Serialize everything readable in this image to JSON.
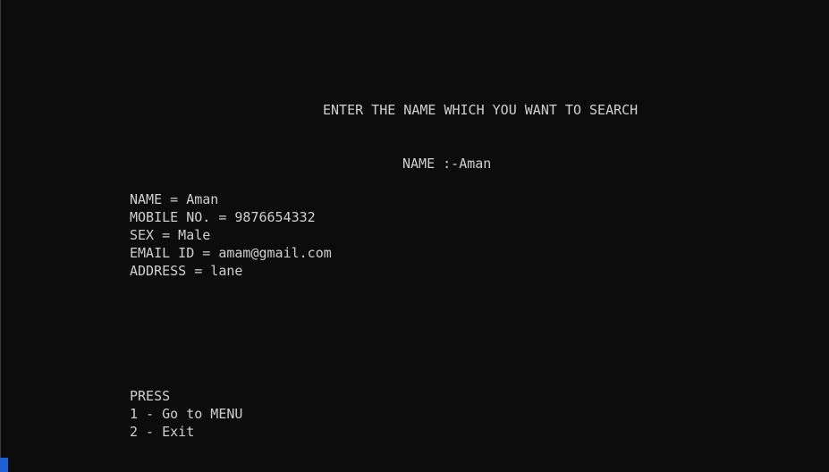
{
  "console": {
    "prompt": "ENTER THE NAME WHICH YOU WANT TO SEARCH",
    "name_input": "NAME :-Aman",
    "record": [
      "NAME = Aman",
      "MOBILE NO. = 9876654332",
      "SEX = Male",
      "EMAIL ID = amam@gmail.com",
      "ADDRESS = lane"
    ],
    "menu": {
      "heading": "PRESS",
      "options": [
        "1 - Go to MENU",
        "2 - Exit"
      ]
    }
  },
  "colors": {
    "background": "#0c0c0c",
    "text": "#d0d0d0",
    "cursor": "#1f5fd6"
  }
}
